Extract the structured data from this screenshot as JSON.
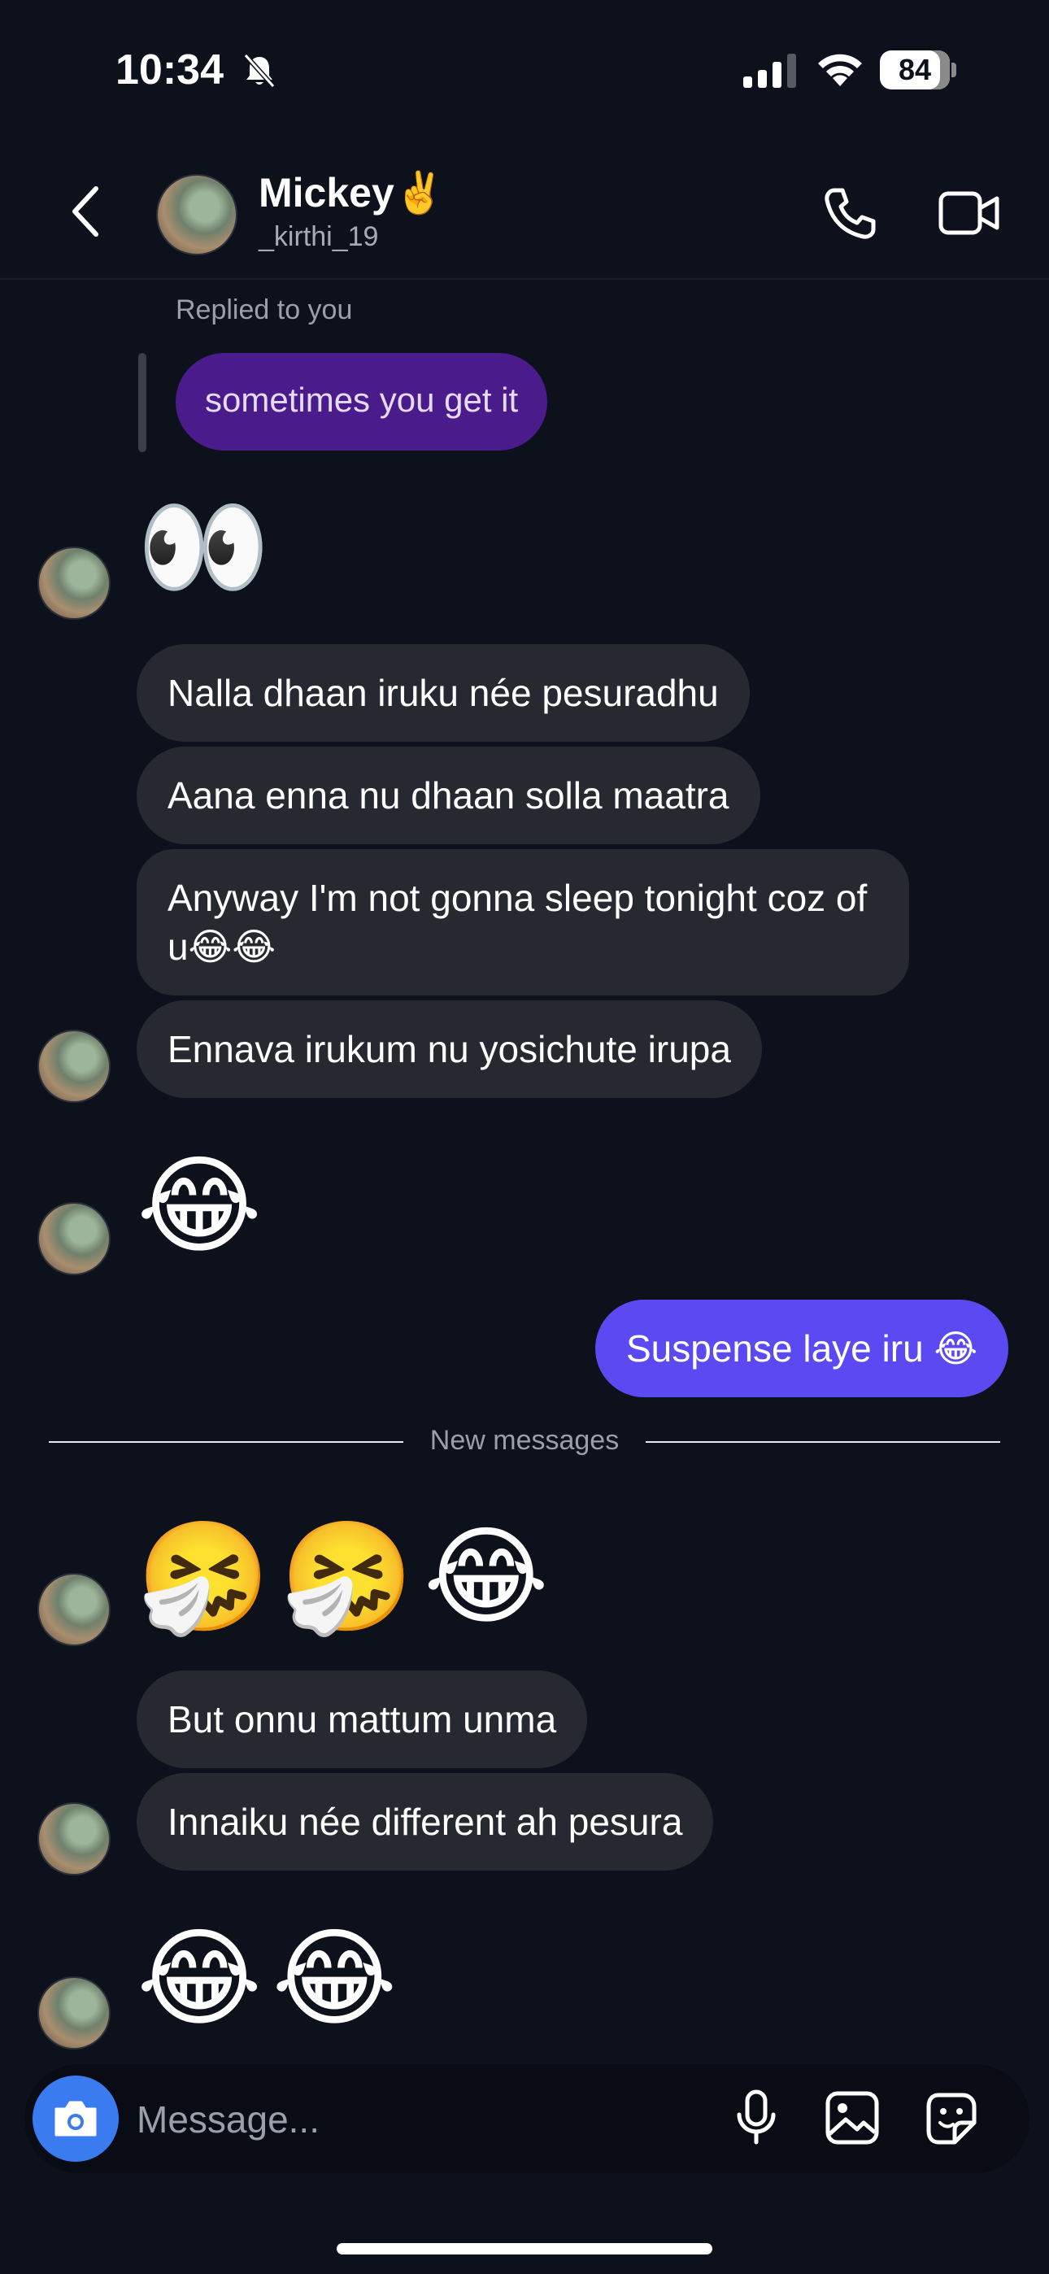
{
  "status_bar": {
    "time": "10:34",
    "battery": "84",
    "icons": [
      "bell-off-icon",
      "signal-icon",
      "wifi-icon",
      "battery-icon"
    ]
  },
  "header": {
    "name": "Mickey✌️",
    "username": "_kirthi_19",
    "icons": [
      "back-chevron-icon",
      "phone-icon",
      "video-camera-icon"
    ]
  },
  "chat": {
    "replied_label": "Replied to you",
    "quoted_message": "sometimes you get it",
    "eyes_emoji": "👀",
    "incoming_1": "Nalla dhaan iruku née pesuradhu",
    "incoming_2": "Aana enna nu dhaan solla maatra",
    "incoming_3": "Anyway I'm not gonna sleep tonight coz of u😂😂",
    "incoming_4": "Ennava irukum nu yosichute irupa",
    "laugh_emoji": "😂",
    "outgoing_1": "Suspense laye iru 😂",
    "divider": "New messages",
    "emoji_row_1": [
      "🤧",
      "🤧",
      "😂"
    ],
    "incoming_5": "But onnu mattum unma",
    "incoming_6": "Innaiku née different ah pesura",
    "emoji_row_2": [
      "😂",
      "😂"
    ]
  },
  "composer": {
    "placeholder": "Message...",
    "icons": [
      "camera-icon",
      "microphone-icon",
      "gallery-icon",
      "sticker-icon"
    ]
  },
  "colors": {
    "background": "#0d111b",
    "incoming_bubble": "#26292f",
    "outgoing_bubble": "#5b4af2",
    "quoted_bubble": "#4a1c8b",
    "camera_button": "#3a7bf0"
  }
}
